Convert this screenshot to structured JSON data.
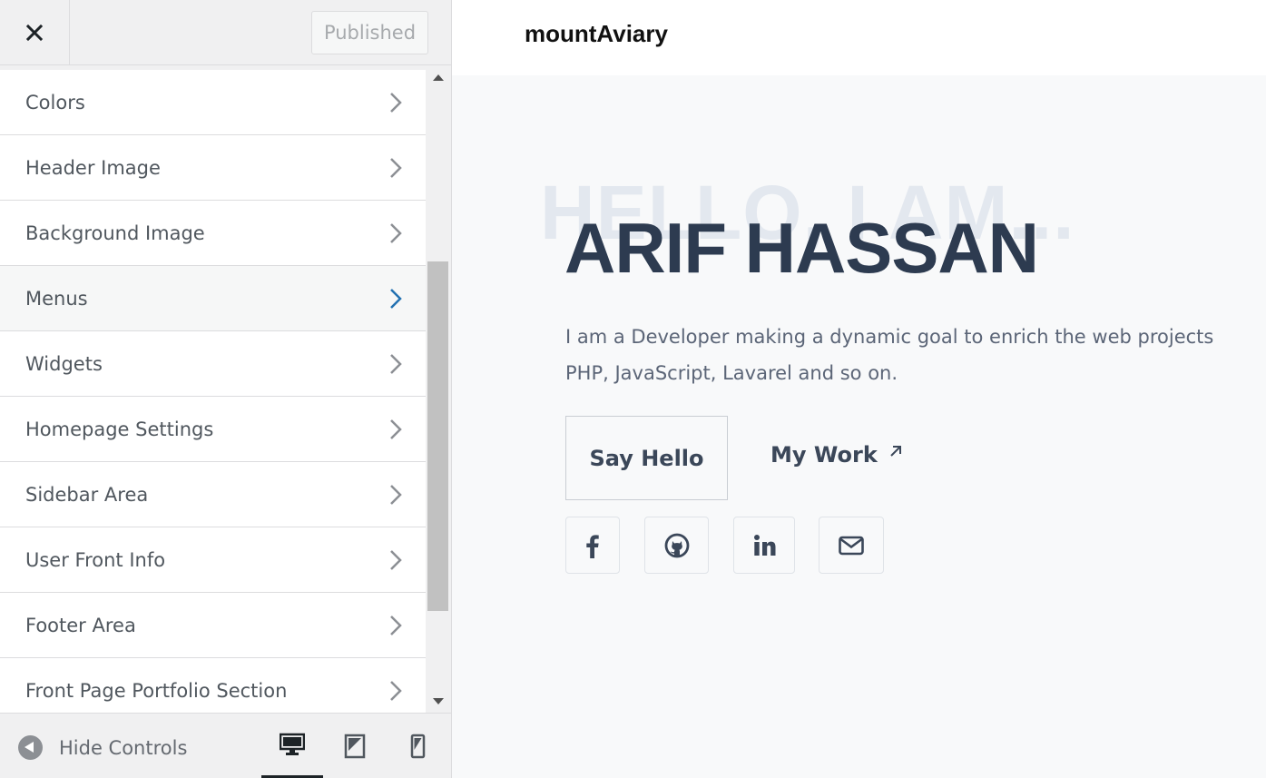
{
  "sidebar": {
    "close_label": "×",
    "publish_label": "Published",
    "items": [
      {
        "label": "Colors"
      },
      {
        "label": "Header Image"
      },
      {
        "label": "Background Image"
      },
      {
        "label": "Menus"
      },
      {
        "label": "Widgets"
      },
      {
        "label": "Homepage Settings"
      },
      {
        "label": "Sidebar Area"
      },
      {
        "label": "User Front Info"
      },
      {
        "label": "Footer Area"
      },
      {
        "label": "Front Page Portfolio Section"
      }
    ],
    "active_item": "Menus",
    "footer": {
      "hide_controls_label": "Hide Controls",
      "devices": [
        "desktop-icon",
        "tablet-icon",
        "mobile-icon"
      ],
      "active_device": "desktop"
    }
  },
  "preview": {
    "site_title": "mountAviary",
    "hello_text": "HELLO, I AM...",
    "name": "ARIF HASSAN",
    "description_line1": "I am a Developer making a dynamic goal to enrich the web projects",
    "description_line2": "PHP, JavaScript, Lavarel and so on.",
    "say_hello_label": "Say Hello",
    "my_work_label": "My Work",
    "social_icons": [
      "facebook-icon",
      "github-icon",
      "linkedin-icon",
      "email-icon"
    ]
  },
  "colors": {
    "accent": "#2271b1",
    "name_color": "#2d3b50",
    "hello_bg_color": "#e3e8ef"
  }
}
